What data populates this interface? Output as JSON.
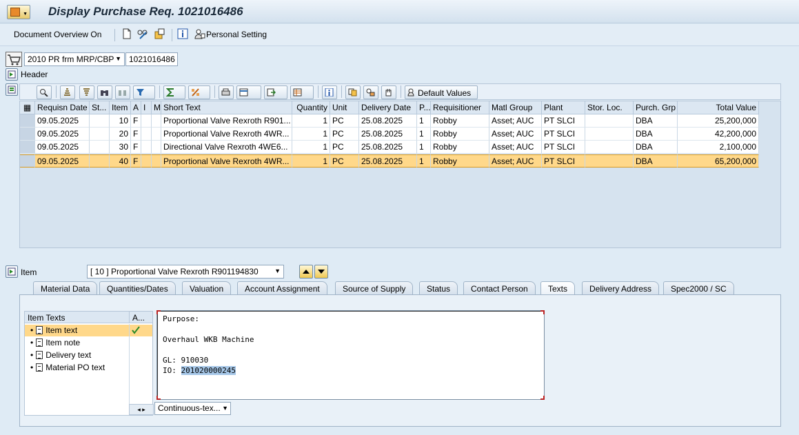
{
  "window": {
    "title": "Display Purchase Req. 1021016486"
  },
  "toolbar": {
    "doc_overview": "Document Overview On",
    "personal_setting": "Personal Setting"
  },
  "header": {
    "doc_type": "2010 PR frm MRP/CBP",
    "doc_number": "1021016486",
    "label": "Header"
  },
  "grid_toolbar": {
    "default_values": "Default Values"
  },
  "table": {
    "columns": [
      "Requisn Date",
      "St...",
      "Item",
      "A",
      "I",
      "Ma",
      "Short Text",
      "Quantity",
      "Unit",
      "Delivery Date",
      "P...",
      "Requisitioner",
      "Matl Group",
      "Plant",
      "Stor. Loc.",
      "Purch. Grp",
      "Total Value"
    ],
    "rows": [
      [
        "09.05.2025",
        "",
        "10",
        "F",
        "",
        "",
        "Proportional Valve Rexroth R901...",
        "1",
        "PC",
        "25.08.2025",
        "1",
        "Robby",
        "Asset; AUC",
        "PT SLCI",
        "",
        "DBA",
        "25,200,000"
      ],
      [
        "09.05.2025",
        "",
        "20",
        "F",
        "",
        "",
        "Proportional Valve Rexroth 4WR...",
        "1",
        "PC",
        "25.08.2025",
        "1",
        "Robby",
        "Asset; AUC",
        "PT SLCI",
        "",
        "DBA",
        "42,200,000"
      ],
      [
        "09.05.2025",
        "",
        "30",
        "F",
        "",
        "",
        "Directional Valve Rexroth 4WE6...",
        "1",
        "PC",
        "25.08.2025",
        "1",
        "Robby",
        "Asset; AUC",
        "PT SLCI",
        "",
        "DBA",
        "2,100,000"
      ],
      [
        "09.05.2025",
        "",
        "40",
        "F",
        "",
        "",
        "Proportional Valve Rexroth 4WR...",
        "1",
        "PC",
        "25.08.2025",
        "1",
        "Robby",
        "Asset; AUC",
        "PT SLCI",
        "",
        "DBA",
        "65,200,000"
      ]
    ],
    "selected_row": 3
  },
  "item": {
    "label": "Item",
    "selected": "[ 10 ] Proportional Valve Rexroth R901194830"
  },
  "tabs": [
    "Material Data",
    "Quantities/Dates",
    "Valuation",
    "Account Assignment",
    "Source of Supply",
    "Status",
    "Contact Person",
    "Texts",
    "Delivery Address",
    "Spec2000 / SC"
  ],
  "active_tab": "Texts",
  "texts": {
    "list_header": "Item Texts",
    "col2_header": "A...",
    "items": [
      "Item text",
      "Item note",
      "Delivery text",
      "Material PO text"
    ],
    "editor": {
      "line1": "Purpose:",
      "line2": "Overhaul WKB Machine",
      "line3": "GL: 910030",
      "line4_label": "IO: ",
      "line4_value": "201020000245"
    },
    "mode": "Continuous-tex..."
  },
  "colors": {
    "selected_row": "#ffd88a",
    "background": "#dfebf5"
  }
}
